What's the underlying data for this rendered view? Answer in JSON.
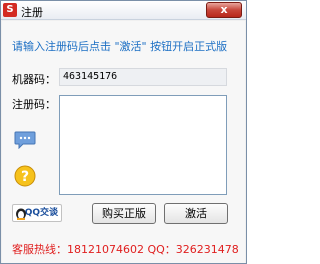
{
  "window": {
    "title": "注册",
    "close_label": "x"
  },
  "main": {
    "instruction": "请输入注册码后点击 \"激活\" 按钮开启正式版",
    "machine_code_label": "机器码：",
    "machine_code_value": "463145176",
    "register_code_label": "注册码：",
    "register_code_value": ""
  },
  "buttons": {
    "qq_label": "QQ交谈",
    "buy_label": "购买正版",
    "activate_label": "激活"
  },
  "footer": {
    "hotline": "客服热线：18121074602 QQ：326231478"
  },
  "colors": {
    "instruction": "#1c6fc4",
    "hotline": "#e01e1e"
  },
  "icons": {
    "app": "app-icon",
    "chat": "chat-bubble-icon",
    "help": "question-icon",
    "qq": "qq-penguin-icon"
  }
}
